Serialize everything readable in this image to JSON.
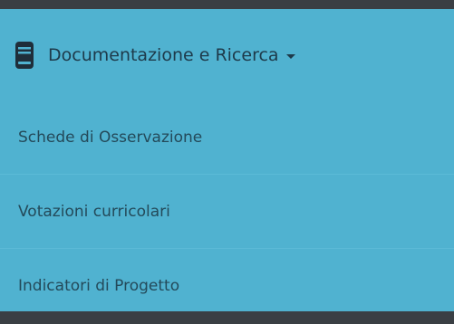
{
  "menu": {
    "header": {
      "icon": "book-icon",
      "label": "Documentazione e Ricerca",
      "caret_icon": "caret-down-icon"
    },
    "items": [
      {
        "label": "Schede di Osservazione"
      },
      {
        "label": "Votazioni curricolari"
      },
      {
        "label": "Indicatori di Progetto"
      }
    ]
  },
  "colors": {
    "background": "#3a3f44",
    "menu_background": "#50b2d0",
    "text": "#1e3a4a"
  }
}
